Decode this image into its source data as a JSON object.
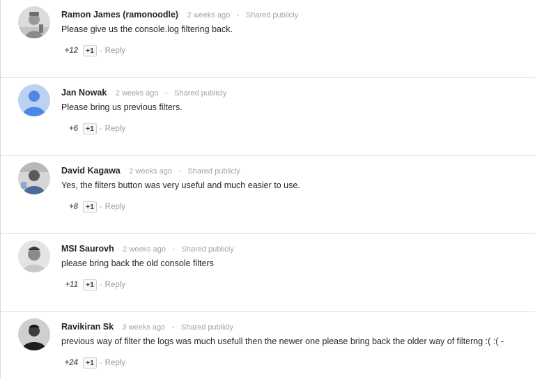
{
  "comments": [
    {
      "author": "Ramon James (ramonoodle)",
      "time": "2 weeks ago",
      "visibility": "Shared publicly",
      "text": "Please give us the console.log filtering back.",
      "plus_count": "+12",
      "plus_one_label": "+1",
      "reply_label": "Reply",
      "avatar": "photo-avatar"
    },
    {
      "author": "Jan Nowak",
      "time": "2 weeks ago",
      "visibility": "Shared publicly",
      "text": "Please bring us previous filters.",
      "plus_count": "+6",
      "plus_one_label": "+1",
      "reply_label": "Reply",
      "avatar": "default-user-avatar"
    },
    {
      "author": "David Kagawa",
      "time": "2 weeks ago",
      "visibility": "Shared publicly",
      "text": "Yes, the filters button was very useful and much easier to use.",
      "plus_count": "+8",
      "plus_one_label": "+1",
      "reply_label": "Reply",
      "avatar": "photo-avatar"
    },
    {
      "author": "MSI Saurovh",
      "time": "2 weeks ago",
      "visibility": "Shared publicly",
      "text": "please bring back the old console filters",
      "plus_count": "+11",
      "plus_one_label": "+1",
      "reply_label": "Reply",
      "avatar": "photo-avatar"
    },
    {
      "author": "Ravikiran Sk",
      "time": "3 weeks ago",
      "visibility": "Shared publicly",
      "text": "previous way of filter the logs was much usefull then the newer one please bring back the older way of filterng :( :( -",
      "plus_count": "+24",
      "plus_one_label": "+1",
      "reply_label": "Reply",
      "avatar": "photo-avatar"
    }
  ],
  "separator": "-",
  "colors": {
    "author": "#262626",
    "meta": "#a3a3a3",
    "default_avatar_bg": "#bcd2f0",
    "default_avatar_fg": "#4e88e6"
  }
}
